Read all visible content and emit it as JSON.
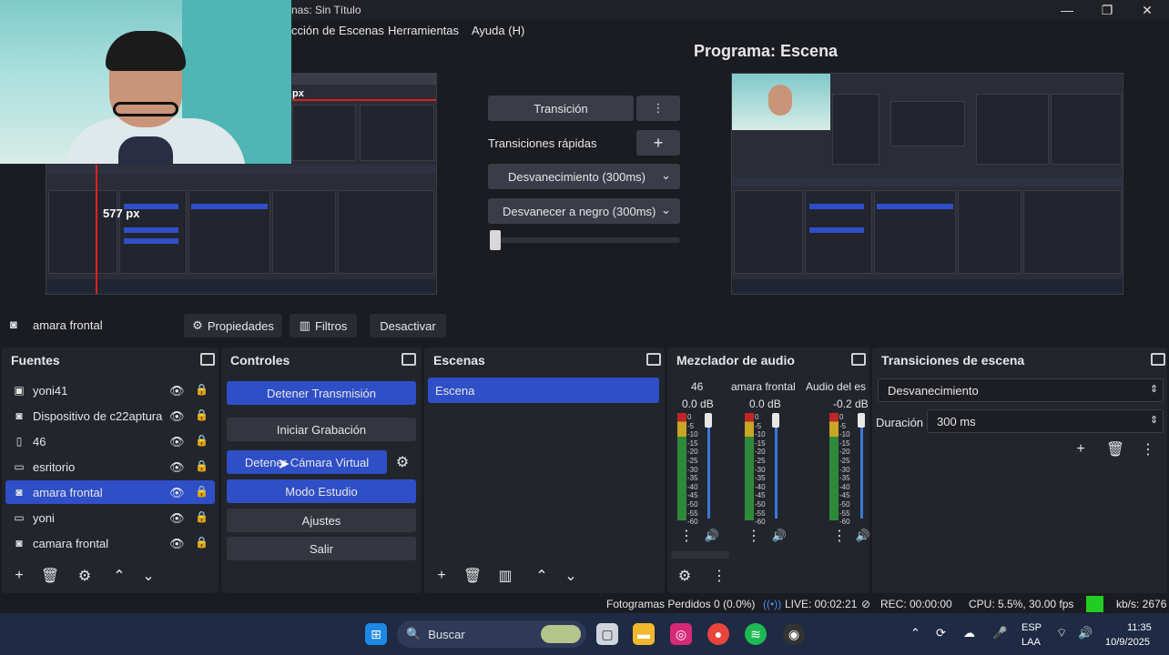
{
  "window": {
    "title": "nas: Sin Título",
    "min": "—",
    "max": "❐",
    "close": "✕"
  },
  "menu": [
    "cción de Escenas",
    "Herramientas",
    "Ayuda (H)"
  ],
  "preview": {
    "size_label": "577 px",
    "size_label_partial": "px"
  },
  "transition": {
    "button": "Transición",
    "quick_label": "Transiciones rápidas",
    "fade": "Desvanecimiento (300ms)",
    "fade_black": "Desvanecer a negro (300ms)"
  },
  "program": {
    "title": "Programa: Escena"
  },
  "source_toolbar": {
    "source_name": "amara frontal",
    "properties": "Propiedades",
    "filters": "Filtros",
    "deactivate": "Desactivar"
  },
  "docks": {
    "sources": {
      "title": "Fuentes"
    },
    "controls": {
      "title": "Controles"
    },
    "scenes": {
      "title": "Escenas"
    },
    "mixer": {
      "title": "Mezclador de audio"
    },
    "transitions": {
      "title": "Transiciones de escena"
    }
  },
  "sources": [
    {
      "name": "yoni41",
      "icon": "window-icon"
    },
    {
      "name": "Dispositivo de c22aptura",
      "icon": "camera-icon"
    },
    {
      "name": "46",
      "icon": "file-icon"
    },
    {
      "name": "esritorio",
      "icon": "monitor-icon"
    },
    {
      "name": "amara frontal",
      "icon": "camera-icon",
      "selected": true
    },
    {
      "name": "yoni",
      "icon": "monitor-icon"
    },
    {
      "name": "camara frontal",
      "icon": "camera-icon"
    }
  ],
  "controls": {
    "stop_stream": "Detener Transmisión",
    "start_record": "Iniciar Grabación",
    "stop_vcam": "Detener Cámara Virtual",
    "studio_mode": "Modo Estudio",
    "settings": "Ajustes",
    "exit": "Salir"
  },
  "scenes": [
    {
      "name": "Escena",
      "selected": true
    }
  ],
  "mixer": {
    "channels": [
      {
        "name": "46",
        "db": "0.0 dB",
        "level": 0.0
      },
      {
        "name": "amara frontal",
        "db": "0.0 dB",
        "level": 0.0
      },
      {
        "name": "Audio del es",
        "db": "-0.2 dB",
        "level": 0.15
      }
    ],
    "scale": [
      "0",
      "-5",
      "-10",
      "-15",
      "-20",
      "-25",
      "-30",
      "-35",
      "-40",
      "-45",
      "-50",
      "-55",
      "-60"
    ]
  },
  "scene_transitions": {
    "selected": "Desvanecimiento",
    "duration_label": "Duración",
    "duration_value": "300 ms"
  },
  "status": {
    "dropped": "Fotogramas Perdidos 0 (0.0%)",
    "live": "LIVE: 00:02:21",
    "rec": "REC: 00:00:00",
    "cpu": "CPU: 5.5%, 30.00 fps",
    "kbs": "kb/s: 2676"
  },
  "taskbar": {
    "search": "Buscar",
    "lang1": "ESP",
    "lang2": "LAA",
    "time": "11:35",
    "date": "10/9/2025"
  },
  "colors": {
    "accent": "#2f4fc7",
    "panel": "#23252d",
    "bg": "#1b1c22",
    "status_green": "#22cc22"
  }
}
